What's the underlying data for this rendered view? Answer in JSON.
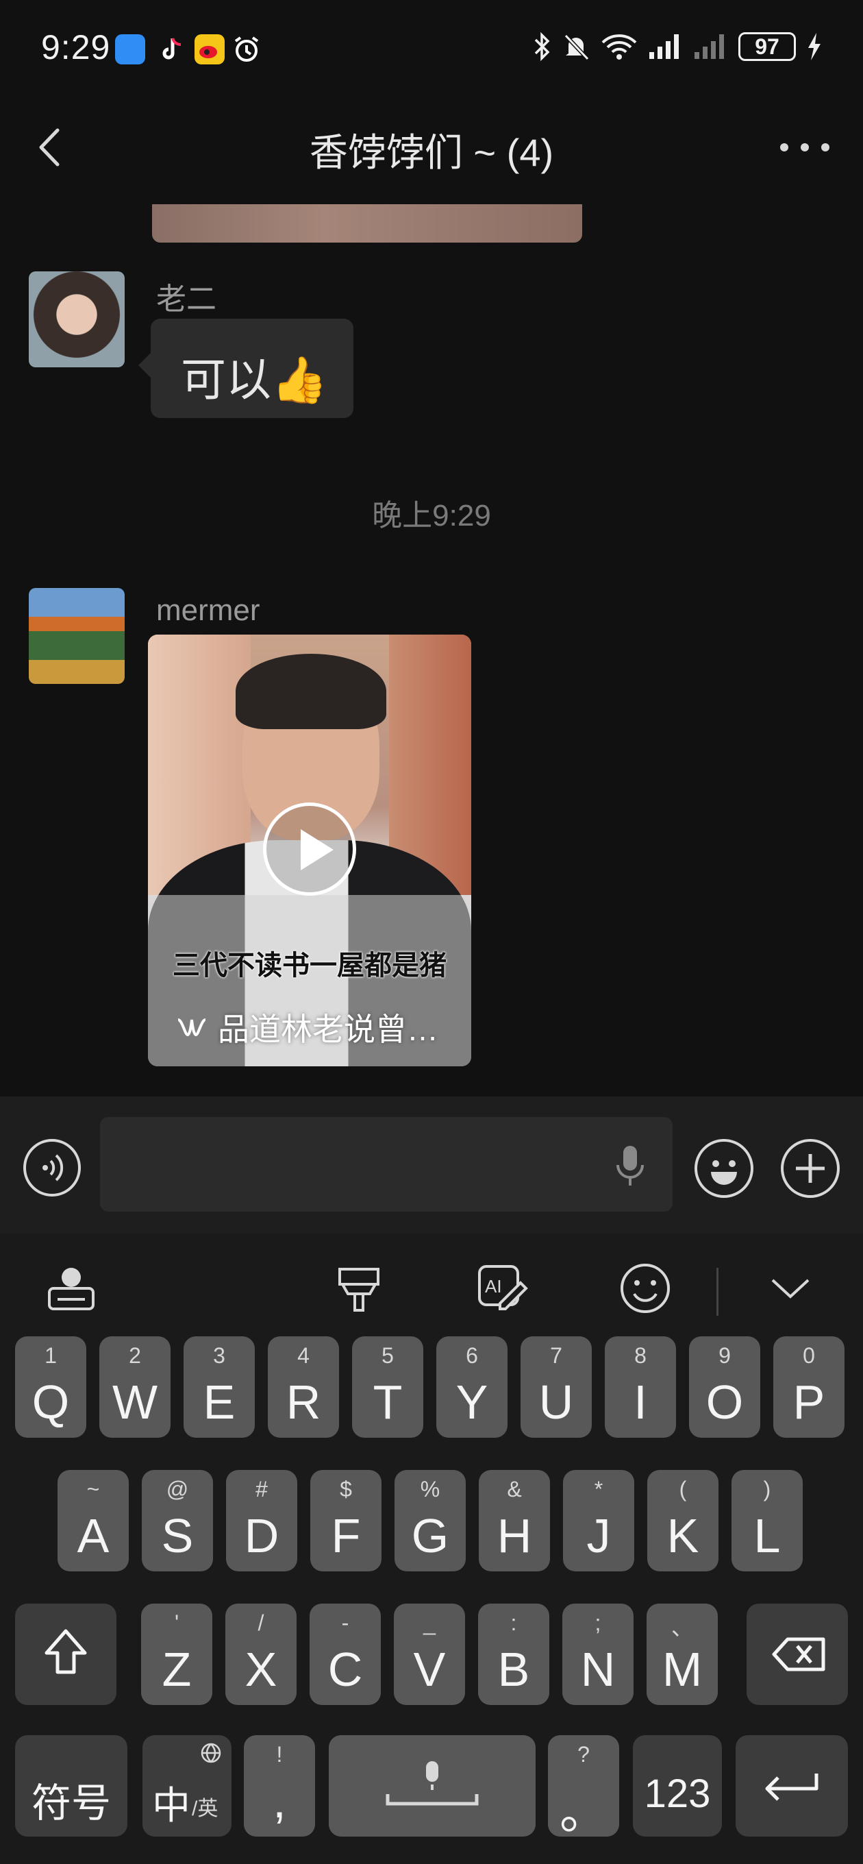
{
  "status_bar": {
    "time": "9:29",
    "battery": "97",
    "icons": [
      "blue-app-icon",
      "tiktok-icon",
      "weibo-icon",
      "alarm-icon",
      "bluetooth-icon",
      "mute-bell-icon",
      "wifi-icon",
      "signal-icon",
      "signal-icon",
      "charging-icon"
    ]
  },
  "header": {
    "title": "香饽饽们 ~ (4)"
  },
  "messages": [
    {
      "sender": "老二",
      "text": "可以👍"
    },
    {
      "timestamp": "晚上9:29"
    },
    {
      "sender": "mermer",
      "video_caption": "三代不读书一屋都是猪",
      "video_source": "品道林老说曾…"
    }
  ],
  "keyboard": {
    "row1": [
      {
        "top": "1",
        "main": "Q"
      },
      {
        "top": "2",
        "main": "W"
      },
      {
        "top": "3",
        "main": "E"
      },
      {
        "top": "4",
        "main": "R"
      },
      {
        "top": "5",
        "main": "T"
      },
      {
        "top": "6",
        "main": "Y"
      },
      {
        "top": "7",
        "main": "U"
      },
      {
        "top": "8",
        "main": "I"
      },
      {
        "top": "9",
        "main": "O"
      },
      {
        "top": "0",
        "main": "P"
      }
    ],
    "row2": [
      {
        "top": "~",
        "main": "A"
      },
      {
        "top": "@",
        "main": "S"
      },
      {
        "top": "#",
        "main": "D"
      },
      {
        "top": "$",
        "main": "F"
      },
      {
        "top": "%",
        "main": "G"
      },
      {
        "top": "&",
        "main": "H"
      },
      {
        "top": "*",
        "main": "J"
      },
      {
        "top": "(",
        "main": "K"
      },
      {
        "top": ")",
        "main": "L"
      }
    ],
    "row3": [
      {
        "top": "'",
        "main": "Z"
      },
      {
        "top": "/",
        "main": "X"
      },
      {
        "top": "-",
        "main": "C"
      },
      {
        "top": "_",
        "main": "V"
      },
      {
        "top": ":",
        "main": "B"
      },
      {
        "top": ";",
        "main": "N"
      },
      {
        "top": "、",
        "main": "M"
      }
    ],
    "bottom": {
      "symbols": "符号",
      "lang_main": "中",
      "lang_sub": "/英",
      "comma_top": "!",
      "comma": ",",
      "period_top": "?",
      "period": "。",
      "numbers": "123"
    }
  }
}
